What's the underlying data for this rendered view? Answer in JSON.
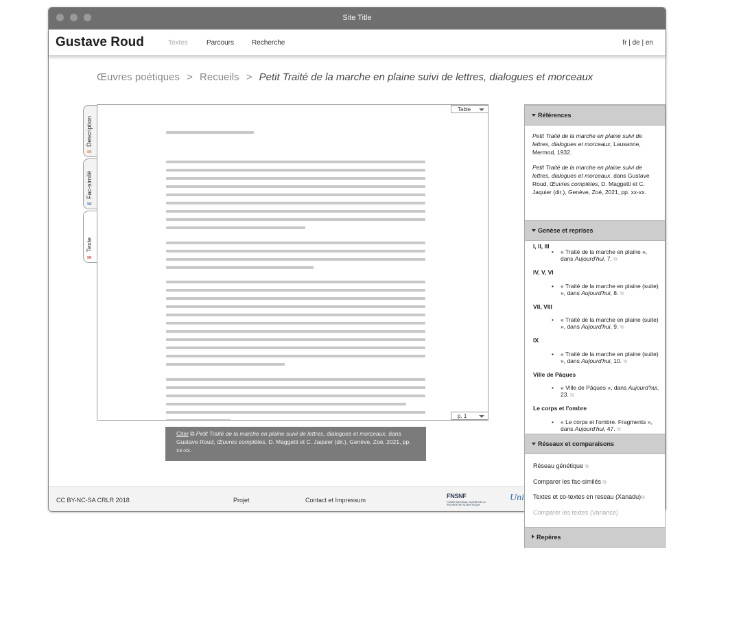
{
  "window": {
    "title": "Site Title"
  },
  "site": {
    "name": "Gustave Roud",
    "nav": {
      "textes": "Textes",
      "parcours": "Parcours",
      "recherche": "Recherche"
    },
    "languages": {
      "fr": "fr",
      "sep1": "|",
      "de": "de",
      "sep2": "|",
      "en": "en"
    }
  },
  "breadcrumb": {
    "root": "Œuvres poétiques",
    "section": "Recueils",
    "separator": ">",
    "current": "Petit Traité de la marche en plaine suivi de lettres, dialogues et morceaux"
  },
  "side_tabs": {
    "description": "Description",
    "facsimile": "Fac-similé",
    "texte": "Texte",
    "icon": "envelope-icon",
    "active": "Texte"
  },
  "viewer": {
    "table_select": "Table",
    "page_select": "p. 1"
  },
  "citation": {
    "link": "Citer",
    "icon": "copy-icon",
    "title": "Petit Traité de la marche en plaine suivi de lettres, dialogues et morceaux",
    "in": ", dans Gustave Roud,",
    "work": "Œuvres complètes",
    "rest": ", D. Maggetti et C. Jaquier (dir.), Genève, Zoé, 2021, pp. xx-xx."
  },
  "footer": {
    "license": "CC BY-NC-SA CRLR 2018",
    "projet": "Projet",
    "contact": "Contact et Impressum",
    "snf_logo": "FNSNF",
    "snf_caption": "FONDS NATIONAL SUISSE DE LA RECHERCHE SCIENTIFIQUE",
    "unil_logo": "Uni"
  },
  "panel": {
    "references": {
      "title": "Références",
      "ref1_title": "Petit Traité de la marche en plaine suivi de lettres, dialogues et morceaux",
      "ref1_rest": ", Lausanne, Mermod, 1932.",
      "ref2_title": "Petit Traité de la marche en plaine suivi de lettres, dialogues et morceaux",
      "ref2_mid": ", dans Gustave Roud, ",
      "ref2_work": "Œuvres complètes",
      "ref2_rest": ", D. Maggetti et C. Jaquier (dir.), Genève, Zoé, 2021, pp. xx-xx."
    },
    "genese": {
      "title": "Genèse et reprises",
      "groups": [
        {
          "head": "I, II, III",
          "item": "« Traité de la marche en plaine », dans ",
          "journal": "Aujourd'hui",
          "page": ", 7."
        },
        {
          "head": "IV, V, VI",
          "item": "« Traité de la marche en plaine (suite) », dans ",
          "journal": "Aujourd'hui",
          "page": ", 8."
        },
        {
          "head": "VII, VIII",
          "item": "« Traité de la marche en plaine (suite) », dans ",
          "journal": "Aujourd'hui",
          "page": ", 9."
        },
        {
          "head": "IX",
          "item": "« Traité de la marche en plaine (suite) », dans ",
          "journal": "Aujourd'hui",
          "page": ", 10."
        },
        {
          "head": "Ville de Pâques",
          "item": "« Ville de Pâques », dans ",
          "journal": "Aujourd'hui",
          "page": ", 23."
        },
        {
          "head": "Le corps et l'ombre",
          "item": "« Le corps et l'ombre. Fragments », dans ",
          "journal": "Aujourd'hui",
          "page": ", 47."
        }
      ]
    },
    "reseaux": {
      "title": "Réseaux et comparaisons",
      "links": [
        "Réseau génétique",
        "Comparer les fac-similés",
        "Textes et co-textes en reseau (Xanadu)",
        "Comparer les textes (Variance)"
      ]
    },
    "reperes": {
      "title": "Repères"
    }
  }
}
